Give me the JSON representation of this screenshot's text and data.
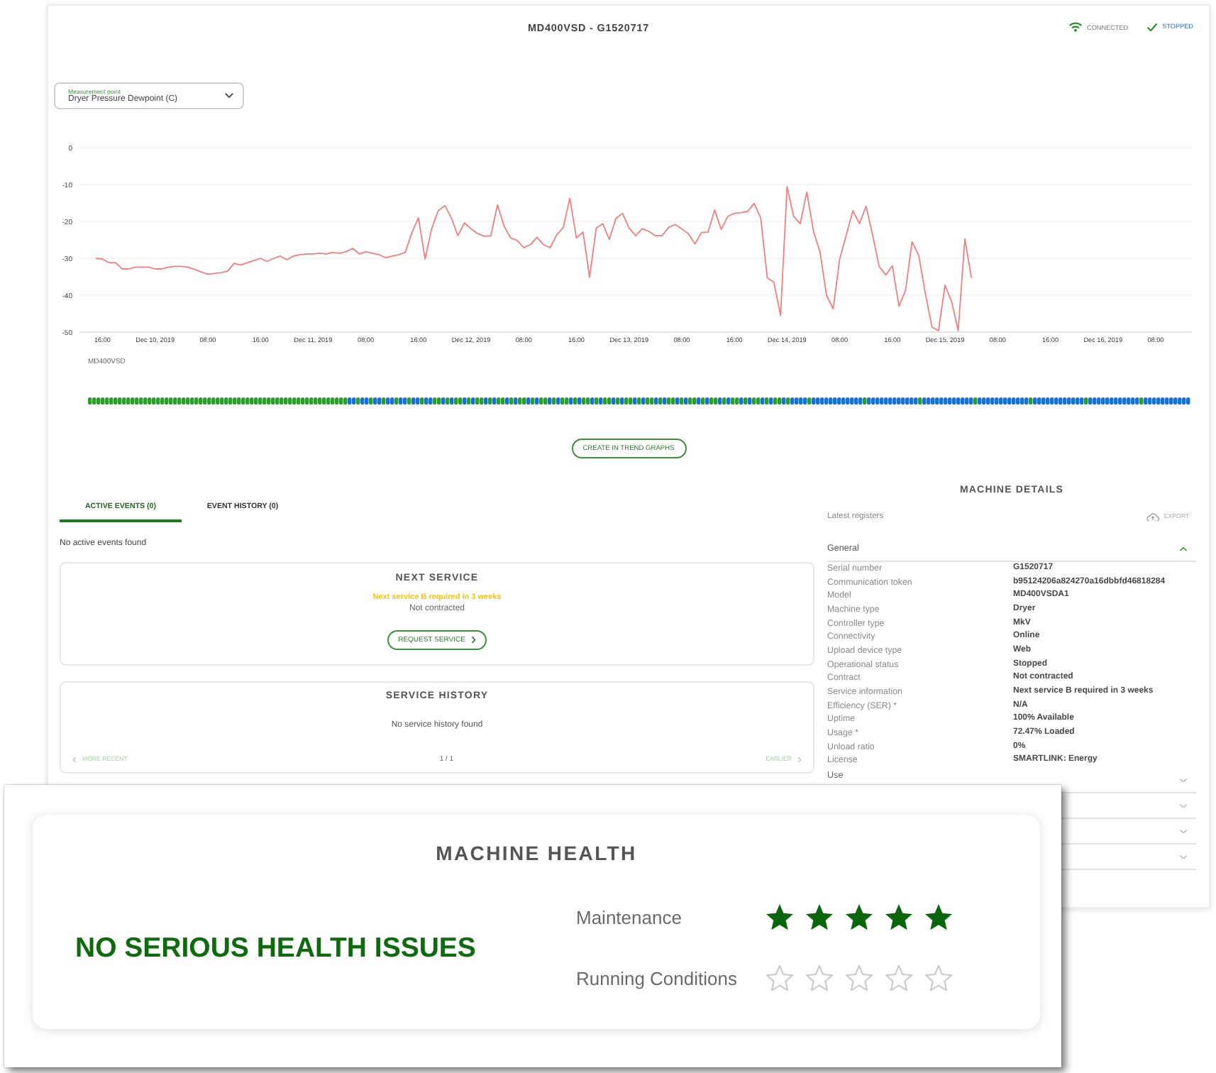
{
  "header": {
    "title": "MD400VSD - G1520717",
    "status": [
      {
        "kind": "connection",
        "label": "CONNECTED"
      },
      {
        "kind": "run_state",
        "label": "STOPPED"
      }
    ]
  },
  "measurement_select": {
    "label": "Measurement point",
    "value": "Dryer Pressure Dewpoint (C)"
  },
  "trend_chart": {
    "chart_data": {
      "type": "line",
      "grid": true,
      "categories": [
        null,
        null,
        null,
        "16:00",
        null,
        null,
        null,
        null,
        null,
        null,
        null,
        "Dec 10, 2019",
        null,
        null,
        null,
        null,
        null,
        null,
        null,
        "08:00",
        null,
        null,
        null,
        null,
        null,
        null,
        null,
        "16:00",
        null,
        null,
        null,
        null,
        null,
        null,
        null,
        "Dec 11, 2019",
        null,
        null,
        null,
        null,
        null,
        null,
        null,
        "08:00",
        null,
        null,
        null,
        null,
        null,
        null,
        null,
        "16:00",
        null,
        null,
        null,
        null,
        null,
        null,
        null,
        "Dec 12, 2019",
        null,
        null,
        null,
        null,
        null,
        null,
        null,
        "08:00",
        null,
        null,
        null,
        null,
        null,
        null,
        null,
        "16:00",
        null,
        null,
        null,
        null,
        null,
        null,
        null,
        "Dec 13, 2019",
        null,
        null,
        null,
        null,
        null,
        null,
        null,
        "08:00",
        null,
        null,
        null,
        null,
        null,
        null,
        null,
        "16:00",
        null,
        null,
        null,
        null,
        null,
        null,
        null,
        "Dec 14, 2019",
        null,
        null,
        null,
        null,
        null,
        null,
        null,
        "08:00",
        null,
        null,
        null,
        null,
        null,
        null,
        null,
        "16:00",
        null,
        null,
        null,
        null,
        null,
        null,
        null,
        "Dec 15, 2019",
        null,
        null,
        null,
        null,
        null,
        null,
        null,
        "08:00",
        null,
        null,
        null,
        null,
        null,
        null,
        null,
        "16:00",
        null,
        null,
        null,
        null,
        null,
        null,
        null,
        "Dec 16, 2019",
        null,
        null,
        null,
        null,
        null,
        null,
        null,
        "08:00",
        null,
        null,
        null,
        null,
        null
      ],
      "values": [
        null,
        null,
        -30,
        -30.2,
        -31.2,
        -31.2,
        -32.9,
        -32.9,
        -32.4,
        -32.4,
        -32.4,
        -32.9,
        -32.9,
        -32.4,
        -32.2,
        -32.2,
        -32.4,
        -33,
        -33.7,
        -34.3,
        -34.1,
        -33.9,
        -33.5,
        -31.4,
        -31.8,
        -31.2,
        -30.6,
        -30,
        -30.8,
        -30,
        -29.4,
        -30.4,
        -29.4,
        -29,
        -28.8,
        -28.8,
        -28.6,
        -28.8,
        -28.4,
        -28.6,
        -28.2,
        -27.3,
        -28.8,
        -28.2,
        -28.6,
        -29,
        -29.8,
        -29.4,
        -29,
        -28.4,
        -23,
        -19,
        -30.2,
        -22,
        -17.1,
        -15.7,
        -19,
        -23.9,
        -20.4,
        -22,
        -23.3,
        -24,
        -23.9,
        -15.5,
        -21.2,
        -24.5,
        -25.1,
        -27.1,
        -26.3,
        -24.3,
        -26.3,
        -27.1,
        -23.7,
        -21.6,
        -13.7,
        -24.5,
        -22.9,
        -35.1,
        -21.8,
        -20.6,
        -24.9,
        -19.2,
        -17.8,
        -21.8,
        -23.9,
        -22,
        -22.7,
        -23.9,
        -23.9,
        -21.6,
        -20.8,
        -22,
        -23.3,
        -26.1,
        -23,
        -22.9,
        -16.9,
        -22.2,
        -18.6,
        -17.8,
        -17.6,
        -17.3,
        -15.1,
        -19,
        -35.3,
        -36.5,
        -45.5,
        -10.6,
        -18.6,
        -20.6,
        -12,
        -22.7,
        -28.2,
        -40,
        -43.7,
        -30.2,
        -23.7,
        -17.1,
        -20.6,
        -15.9,
        -23.7,
        -32.2,
        -34.5,
        -32,
        -43,
        -38.6,
        -25.5,
        -29.2,
        -39.4,
        -48.6,
        -49.6,
        -37.3,
        -41.8,
        -49.6,
        -24.7,
        -35.3,
        null,
        null,
        null,
        null,
        null,
        null,
        null,
        null,
        null,
        null,
        null,
        null,
        null,
        null,
        null,
        null,
        null,
        null,
        null,
        null,
        null,
        null,
        null,
        null,
        null,
        null,
        null,
        null,
        null,
        null,
        null,
        null,
        null
      ],
      "ylim": [
        -50,
        0
      ],
      "yticks": [
        0,
        -10,
        -20,
        -30,
        -40,
        -50
      ]
    }
  },
  "status_timeline": {
    "label": "MD400VSD"
  },
  "trend_button": "CREATE IN TREND GRAPHS",
  "events": {
    "tabs": [
      {
        "label": "ACTIVE EVENTS (0)",
        "selected": true
      },
      {
        "label": "EVENT HISTORY (0)",
        "selected": false
      }
    ],
    "message": "No active events found"
  },
  "next_service": {
    "title": "NEXT SERVICE",
    "notice": "Next service B required in 3 weeks",
    "contract": "Not contracted",
    "button": "REQUEST SERVICE"
  },
  "service_history": {
    "title": "SERVICE HISTORY",
    "message": "No service history found",
    "pager": {
      "previous": {
        "label": "MORE RECENT",
        "disabled": true
      },
      "page": "1 / 1",
      "next": {
        "label": "EARLIER",
        "disabled": true
      }
    }
  },
  "machine_details": {
    "title": "MACHINE DETAILS",
    "subtitle": "Latest registers",
    "export_button": "EXPORT",
    "sections": [
      {
        "title": "General",
        "expanded": true,
        "rows": [
          {
            "label": "Serial number",
            "value": "G1520717"
          },
          {
            "label": "Communication token",
            "value": "b95124206a824270a16dbbfd46818284"
          },
          {
            "label": "Model",
            "value": "MD400VSDA1"
          },
          {
            "label": "Machine type",
            "value": "Dryer"
          },
          {
            "label": "Controller type",
            "value": "MkV"
          },
          {
            "label": "Connectivity",
            "value": "Online"
          },
          {
            "label": "Upload device type",
            "value": "Web"
          },
          {
            "label": "Operational status",
            "value": "Stopped"
          },
          {
            "label": "Contract",
            "value": "Not contracted"
          },
          {
            "label": "Service information",
            "value": "Next service B required in 3 weeks"
          },
          {
            "label": "Efficiency (SER) *",
            "value": "N/A"
          },
          {
            "label": "Uptime",
            "value": "100% Available"
          },
          {
            "label": "Usage *",
            "value": "72.47% Loaded"
          },
          {
            "label": "Unload ratio",
            "value": "0%"
          },
          {
            "label": "License",
            "value": "SMARTLINK: Energy"
          }
        ]
      },
      {
        "title": "Use",
        "expanded": false
      },
      {
        "expanded": false
      },
      {
        "expanded": false
      },
      {
        "expanded": false
      }
    ]
  },
  "health": {
    "title": "MACHINE HEALTH",
    "summary": "NO SERIOUS HEALTH ISSUES",
    "ratings": [
      {
        "label": "Maintenance",
        "stars": 5
      },
      {
        "label": "Running Conditions",
        "stars": 0
      }
    ]
  }
}
